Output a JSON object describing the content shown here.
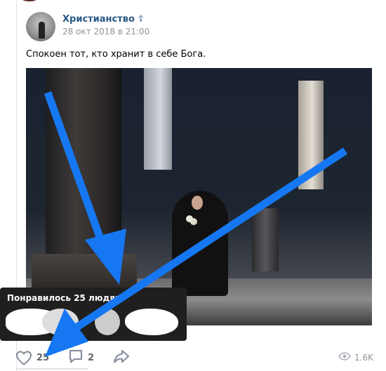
{
  "post": {
    "author": "Христианство ☦",
    "date": "28 окт 2018 в 21:00",
    "text": "Спокоен тот, кто хранит в себе Бога."
  },
  "tooltip": {
    "title": "Понравилось 25 людям"
  },
  "actions": {
    "likes": "25",
    "comments": "2",
    "views": "1.6K"
  },
  "colors": {
    "link": "#2a5885",
    "annotation_arrow": "#1677f2",
    "tooltip_bg": "#1f1f1f"
  },
  "icons": [
    "heart-icon",
    "comment-icon",
    "share-icon",
    "eye-icon"
  ]
}
